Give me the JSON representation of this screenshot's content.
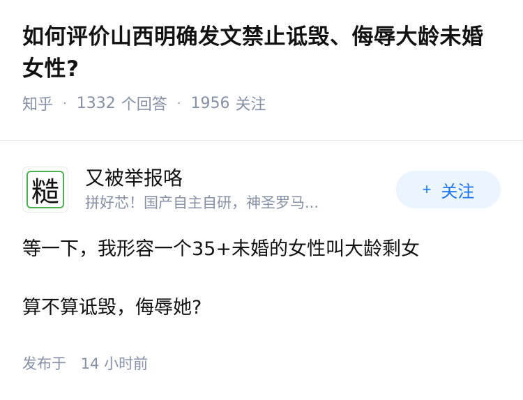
{
  "question": {
    "title": "如何评价山西明确发文禁止诋毁、侮辱大龄未婚女性?",
    "source": "知乎",
    "answer_count": "1332",
    "answer_label": "个回答",
    "follower_count": "1956",
    "follower_label": "关注"
  },
  "answer": {
    "author": {
      "avatar_char": "糙",
      "name": "又被举报咯",
      "bio": "拼好芯！国产自主自研，神圣罗马..."
    },
    "follow_button": {
      "plus": "+",
      "label": "关注"
    },
    "paragraphs": [
      "等一下，我形容一个35+未婚的女性叫大龄剩女",
      "算不算诋毁，侮辱她?"
    ],
    "published_label": "发布于",
    "published_time": "14 小时前"
  },
  "colors": {
    "text": "#121212",
    "meta": "#8590a6",
    "follow_bg": "#ebf5ff",
    "follow_text": "#1772f6",
    "avatar_border": "#4caf50"
  }
}
